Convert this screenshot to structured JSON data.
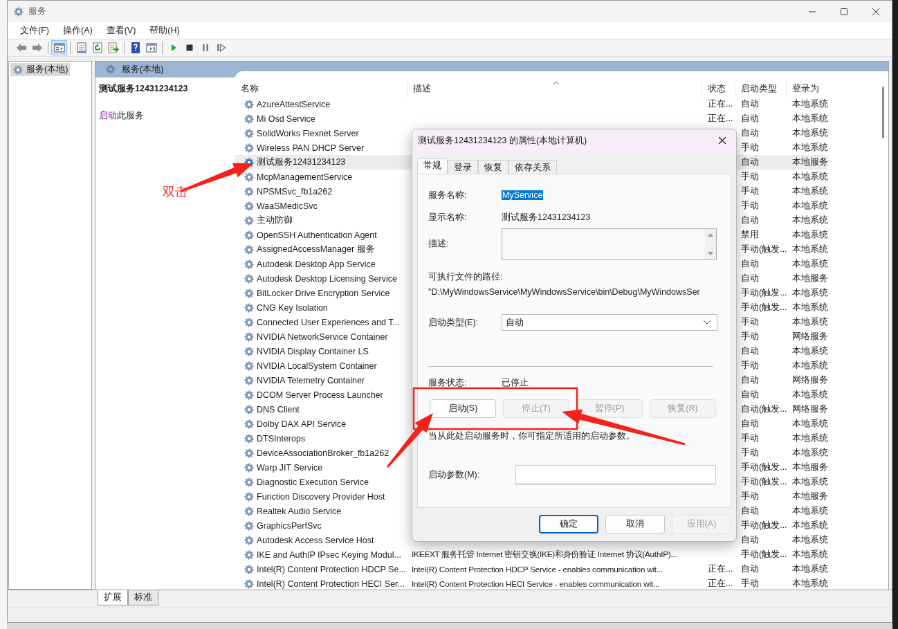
{
  "window": {
    "title": "服务"
  },
  "menu": [
    "文件(F)",
    "操作(A)",
    "查看(V)",
    "帮助(H)"
  ],
  "toolbar_groups": [
    [
      {
        "kind": "back",
        "pressed": false
      },
      {
        "kind": "forward",
        "pressed": false
      }
    ],
    [
      {
        "kind": "tree",
        "pressed": true
      }
    ],
    [
      {
        "kind": "properties",
        "pressed": false
      },
      {
        "kind": "refresh",
        "pressed": false
      },
      {
        "kind": "export",
        "pressed": false
      }
    ],
    [
      {
        "kind": "help",
        "pressed": false
      },
      {
        "kind": "pane",
        "pressed": false
      }
    ],
    [
      {
        "kind": "play",
        "pressed": false
      },
      {
        "kind": "stop",
        "pressed": false
      },
      {
        "kind": "pause",
        "pressed": false
      },
      {
        "kind": "resume",
        "pressed": false
      }
    ]
  ],
  "tree": {
    "items": [
      {
        "label": "服务(本地)",
        "selected": true
      }
    ]
  },
  "pane_title": "服务(本地)",
  "info": {
    "title": "测试服务12431234123",
    "action_link": "启动",
    "action_text": "此服务"
  },
  "table": {
    "columns": [
      "名称",
      "描述",
      "状态",
      "启动类型",
      "登录为"
    ],
    "rows": [
      {
        "name": "AzureAttestService",
        "status": "正在...",
        "startup": "自动",
        "login": "本地系统",
        "selected": false
      },
      {
        "name": "Mi Osd Service",
        "status": "正在...",
        "startup": "自动",
        "login": "本地系统",
        "selected": false
      },
      {
        "name": "SolidWorks Flexnet Server",
        "startup": "自动",
        "login": "本地系统",
        "selected": false
      },
      {
        "name": "Wireless PAN DHCP Server",
        "startup": "手动",
        "login": "本地系统",
        "selected": false
      },
      {
        "name": "测试服务12431234123",
        "startup": "自动",
        "login": "本地服务",
        "selected": true
      },
      {
        "name": "McpManagementService",
        "startup": "手动",
        "login": "本地系统",
        "selected": false
      },
      {
        "name": "NPSMSvc_fb1a262",
        "startup": "手动",
        "login": "本地系统",
        "selected": false
      },
      {
        "name": "WaaSMedicSvc",
        "startup": "手动",
        "login": "本地系统",
        "selected": false
      },
      {
        "name": "主动防御",
        "startup": "自动",
        "login": "本地系统",
        "selected": false
      },
      {
        "name": "OpenSSH Authentication Agent",
        "startup": "禁用",
        "login": "本地系统",
        "selected": false
      },
      {
        "name": "AssignedAccessManager 服务",
        "startup": "手动(触发...",
        "login": "本地系统",
        "selected": false
      },
      {
        "name": "Autodesk Desktop App Service",
        "startup": "自动",
        "login": "本地系统",
        "selected": false
      },
      {
        "name": "Autodesk Desktop Licensing Service",
        "startup": "自动",
        "login": "本地服务",
        "selected": false
      },
      {
        "name": "BitLocker Drive Encryption Service",
        "startup": "手动(触发...",
        "login": "本地系统",
        "selected": false
      },
      {
        "name": "CNG Key Isolation",
        "startup": "手动(触发...",
        "login": "本地系统",
        "selected": false
      },
      {
        "name": "Connected User Experiences and T...",
        "startup": "手动",
        "login": "本地系统",
        "selected": false
      },
      {
        "name": "NVIDIA NetworkService Container",
        "startup": "手动",
        "login": "网络服务",
        "selected": false
      },
      {
        "name": "NVIDIA Display Container LS",
        "startup": "自动",
        "login": "本地系统",
        "selected": false
      },
      {
        "name": "NVIDIA LocalSystem Container",
        "startup": "手动",
        "login": "本地系统",
        "selected": false
      },
      {
        "name": "NVIDIA Telemetry Container",
        "startup": "自动",
        "login": "网络服务",
        "selected": false
      },
      {
        "name": "DCOM Server Process Launcher",
        "startup": "自动",
        "login": "本地系统",
        "selected": false
      },
      {
        "name": "DNS Client",
        "startup": "自动(触发...",
        "login": "网络服务",
        "selected": false
      },
      {
        "name": "Dolby DAX API Service",
        "startup": "自动",
        "login": "本地系统",
        "selected": false
      },
      {
        "name": "DTSInterops",
        "startup": "手动",
        "login": "本地系统",
        "selected": false
      },
      {
        "name": "DeviceAssociationBroker_fb1a262",
        "startup": "手动",
        "login": "本地系统",
        "selected": false
      },
      {
        "name": "Warp JIT Service",
        "startup": "手动(触发...",
        "login": "本地服务",
        "selected": false
      },
      {
        "name": "Diagnostic Execution Service",
        "startup": "手动(触发...",
        "login": "本地系统",
        "selected": false
      },
      {
        "name": "Function Discovery Provider Host",
        "startup": "手动",
        "login": "本地服务",
        "selected": false
      },
      {
        "name": "Realtek Audio Service",
        "startup": "自动",
        "login": "本地系统",
        "selected": false
      },
      {
        "name": "GraphicsPerfSvc",
        "startup": "手动(触发...",
        "login": "本地系统",
        "selected": false
      },
      {
        "name": "Autodesk Access Service Host",
        "startup": "自动",
        "login": "本地系统",
        "selected": false
      },
      {
        "name": "IKE and AuthIP IPsec Keying Modul...",
        "description": "IKEEXT 服务托管 Internet 密钥交换(IKE)和身份验证 Internet 协议(AuthIP)...",
        "startup": "手动(触发...",
        "login": "本地系统",
        "selected": false
      },
      {
        "name": "Intel(R) Content Protection HDCP Se...",
        "description": "Intel(R) Content Protection HDCP Service - enables communication wit...",
        "status": "正在...",
        "startup": "自动",
        "login": "本地系统",
        "selected": false
      },
      {
        "name": "Intel(R) Content Protection HECI Ser...",
        "description": "Intel(R) Content Protection HECI Service - enables communication wit...",
        "status": "正在...",
        "startup": "手动",
        "login": "本地系统",
        "selected": false
      }
    ]
  },
  "view_tabs": [
    {
      "label": "扩展",
      "selected": true
    },
    {
      "label": "标准",
      "selected": false
    }
  ],
  "dialog": {
    "title": "测试服务12431234123 的属性(本地计算机)",
    "tabs": [
      {
        "label": "常规",
        "selected": true
      },
      {
        "label": "登录",
        "selected": false
      },
      {
        "label": "恢复",
        "selected": false
      },
      {
        "label": "依存关系",
        "selected": false
      }
    ],
    "service_name_label": "服务名称:",
    "service_name": "MyService",
    "service_name_selected": true,
    "display_name_label": "显示名称:",
    "display_name": "测试服务12431234123",
    "description_label": "描述:",
    "path_label": "可执行文件的路径:",
    "path": "\"D:\\MyWindowsService\\MyWindowsService\\bin\\Debug\\MyWindowsSer",
    "startup_type_label": "启动类型(E):",
    "startup_type": "自动",
    "status_label": "服务状态:",
    "status": "已停止",
    "service_buttons": [
      {
        "label": "启动(S)",
        "disabled": false
      },
      {
        "label": "停止(T)",
        "disabled": true
      },
      {
        "label": "暂停(P)",
        "disabled": true
      },
      {
        "label": "恢复(R)",
        "disabled": true
      }
    ],
    "hint": "当从此处启动服务时，你可指定所适用的启动参数。",
    "params_label": "启动参数(M):",
    "buttons": [
      {
        "label": "确定",
        "disabled": false,
        "default": true
      },
      {
        "label": "取消",
        "disabled": false,
        "default": false
      },
      {
        "label": "应用(A)",
        "disabled": true,
        "default": false
      }
    ]
  },
  "annotation": {
    "label": "双击"
  }
}
